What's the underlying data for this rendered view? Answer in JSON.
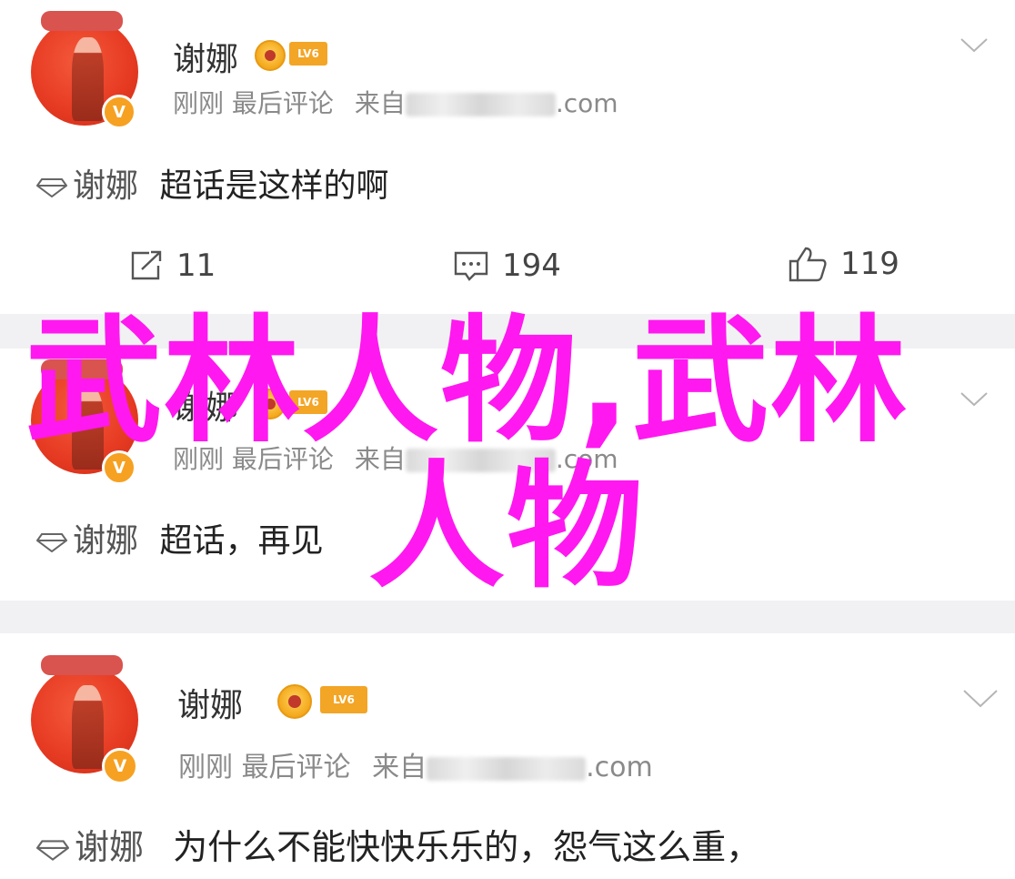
{
  "posts": [
    {
      "username": "谢娜",
      "lv_badge": "LV6",
      "time": "刚刚",
      "action": "最后评论",
      "source_prefix": "来自",
      "source_suffix": ".com",
      "topic_tag": "谢娜",
      "text": "超话是这样的啊",
      "repost_count": "11",
      "comment_count": "194",
      "like_count": "119"
    },
    {
      "username": "谢娜",
      "lv_badge": "LV6",
      "time": "刚刚",
      "action": "最后评论",
      "source_prefix": "来自",
      "source_suffix": ".com",
      "topic_tag": "谢娜",
      "text": "超话，再见"
    },
    {
      "username": "谢娜",
      "lv_badge": "LV6",
      "time": "刚刚",
      "action": "最后评论",
      "source_prefix": "来自",
      "source_suffix": ".com",
      "topic_tag": "谢娜",
      "text": "为什么不能快快乐乐的，怨气这么重，"
    }
  ],
  "overlay": {
    "line1": "武林人物,武林",
    "line2": "人物",
    "color": "#ff18f0"
  },
  "icons": {
    "repost": "repost-icon",
    "comment": "comment-icon",
    "like": "thumbs-up-icon",
    "chevron": "chevron-down-icon",
    "topic": "supertopic-gem-icon",
    "verified": "verified-v-icon"
  }
}
